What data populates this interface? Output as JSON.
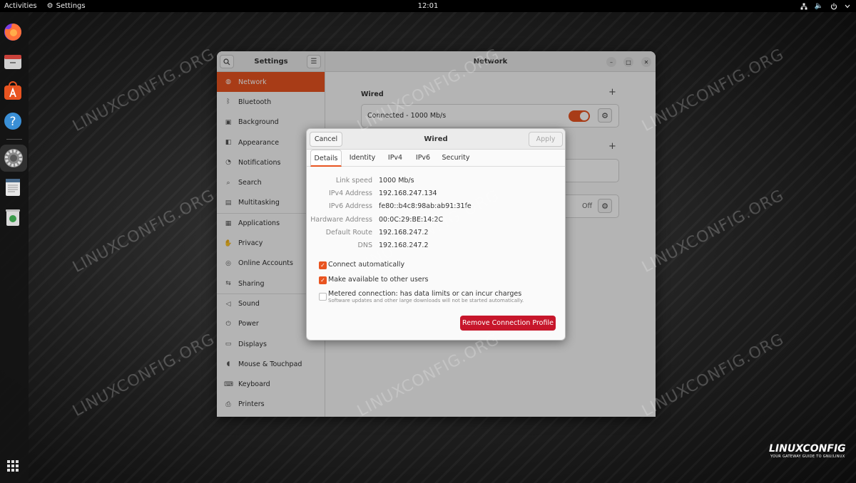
{
  "topbar": {
    "activities": "Activities",
    "app_name": "Settings",
    "clock": "12:01"
  },
  "settings": {
    "sidebar_title": "Settings",
    "page_title": "Network",
    "sidebar_items": [
      {
        "label": "Network",
        "icon": "network-icon",
        "selected": true
      },
      {
        "label": "Bluetooth",
        "icon": "bluetooth-icon"
      },
      {
        "label": "Background",
        "icon": "background-icon"
      },
      {
        "label": "Appearance",
        "icon": "appearance-icon"
      },
      {
        "label": "Notifications",
        "icon": "notifications-icon"
      },
      {
        "label": "Search",
        "icon": "search-icon"
      },
      {
        "label": "Multitasking",
        "icon": "multitasking-icon"
      },
      {
        "label": "Applications",
        "icon": "applications-icon"
      },
      {
        "label": "Privacy",
        "icon": "privacy-icon"
      },
      {
        "label": "Online Accounts",
        "icon": "online-accounts-icon"
      },
      {
        "label": "Sharing",
        "icon": "sharing-icon"
      },
      {
        "label": "Sound",
        "icon": "sound-icon"
      },
      {
        "label": "Power",
        "icon": "power-icon"
      },
      {
        "label": "Displays",
        "icon": "displays-icon"
      },
      {
        "label": "Mouse & Touchpad",
        "icon": "mouse-icon"
      },
      {
        "label": "Keyboard",
        "icon": "keyboard-icon"
      },
      {
        "label": "Printers",
        "icon": "printers-icon"
      }
    ],
    "wired": {
      "title": "Wired",
      "status": "Connected - 1000 Mb/s",
      "toggle_on": true
    },
    "proxy": {
      "status": "Off"
    }
  },
  "dialog": {
    "title": "Wired",
    "cancel": "Cancel",
    "apply": "Apply",
    "tabs": [
      "Details",
      "Identity",
      "IPv4",
      "IPv6",
      "Security"
    ],
    "active_tab": "Details",
    "details": [
      {
        "label": "Link speed",
        "value": "1000 Mb/s"
      },
      {
        "label": "IPv4 Address",
        "value": "192.168.247.134"
      },
      {
        "label": "IPv6 Address",
        "value": "fe80::b4c8:98ab:ab91:31fe"
      },
      {
        "label": "Hardware Address",
        "value": "00:0C:29:BE:14:2C"
      },
      {
        "label": "Default Route",
        "value": "192.168.247.2"
      },
      {
        "label": "DNS",
        "value": "192.168.247.2"
      }
    ],
    "connect_automatically": {
      "label": "Connect automatically",
      "checked": true
    },
    "available_to_others": {
      "label": "Make available to other users",
      "checked": true
    },
    "metered": {
      "label": "Metered connection: has data limits or can incur charges",
      "sub": "Software updates and other large downloads will not be started automatically.",
      "checked": false
    },
    "remove_button": "Remove Connection Profile"
  },
  "watermark": "LINUXCONFIG.ORG",
  "logo": {
    "text": "LINUXCONFIG",
    "tagline": "YOUR GATEWAY GUIDE TO GNU/LINUX"
  },
  "colors": {
    "accent": "#e95420",
    "danger": "#c7162b"
  }
}
